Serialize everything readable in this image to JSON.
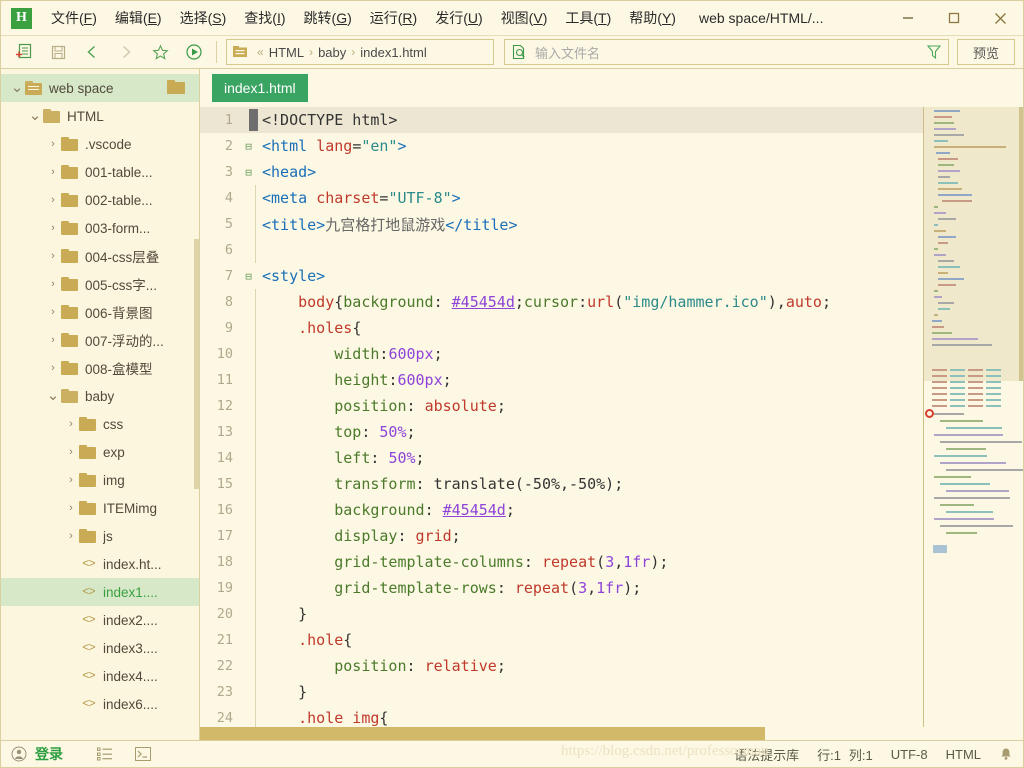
{
  "window": {
    "logo_text": "H",
    "title": "web space/HTML/...",
    "minimize": "—",
    "maximize": "□",
    "close": "✕"
  },
  "menu": [
    {
      "label": "文件",
      "accel": "F"
    },
    {
      "label": "编辑",
      "accel": "E"
    },
    {
      "label": "选择",
      "accel": "S"
    },
    {
      "label": "查找",
      "accel": "I"
    },
    {
      "label": "跳转",
      "accel": "G"
    },
    {
      "label": "运行",
      "accel": "R"
    },
    {
      "label": "发行",
      "accel": "U"
    },
    {
      "label": "视图",
      "accel": "V"
    },
    {
      "label": "工具",
      "accel": "T"
    },
    {
      "label": "帮助",
      "accel": "Y"
    }
  ],
  "toolbar": {
    "icons": [
      "new-file-icon",
      "save-icon",
      "back-icon",
      "forward-icon",
      "favorite-icon",
      "run-icon"
    ],
    "breadcrumb": {
      "prefix": "«",
      "segments": [
        "HTML",
        "baby",
        "index1.html"
      ],
      "separator": "›"
    },
    "search_placeholder": "输入文件名",
    "filter_icon": "filter-icon",
    "preview_label": "预览"
  },
  "sidebar": {
    "items": [
      {
        "label": "web space",
        "type": "folder-open",
        "depth": 0,
        "arrow": "v",
        "selected": true,
        "trailing_folder": true
      },
      {
        "label": "HTML",
        "type": "folder-open",
        "depth": 1,
        "arrow": "v",
        "selected": false
      },
      {
        "label": ".vscode",
        "type": "folder",
        "depth": 2,
        "arrow": ">",
        "selected": false
      },
      {
        "label": "001-table...",
        "type": "folder",
        "depth": 2,
        "arrow": ">",
        "selected": false
      },
      {
        "label": "002-table...",
        "type": "folder",
        "depth": 2,
        "arrow": ">",
        "selected": false
      },
      {
        "label": "003-form...",
        "type": "folder",
        "depth": 2,
        "arrow": ">",
        "selected": false
      },
      {
        "label": "004-css层叠",
        "type": "folder",
        "depth": 2,
        "arrow": ">",
        "selected": false
      },
      {
        "label": "005-css字...",
        "type": "folder",
        "depth": 2,
        "arrow": ">",
        "selected": false
      },
      {
        "label": "006-背景图",
        "type": "folder",
        "depth": 2,
        "arrow": ">",
        "selected": false
      },
      {
        "label": "007-浮动的...",
        "type": "folder",
        "depth": 2,
        "arrow": ">",
        "selected": false
      },
      {
        "label": "008-盒模型",
        "type": "folder",
        "depth": 2,
        "arrow": ">",
        "selected": false
      },
      {
        "label": "baby",
        "type": "folder-open",
        "depth": 2,
        "arrow": "v",
        "selected": false
      },
      {
        "label": "css",
        "type": "folder",
        "depth": 3,
        "arrow": ">",
        "selected": false
      },
      {
        "label": "exp",
        "type": "folder",
        "depth": 3,
        "arrow": ">",
        "selected": false
      },
      {
        "label": "img",
        "type": "folder",
        "depth": 3,
        "arrow": ">",
        "selected": false
      },
      {
        "label": "ITEMimg",
        "type": "folder",
        "depth": 3,
        "arrow": ">",
        "selected": false
      },
      {
        "label": "js",
        "type": "folder",
        "depth": 3,
        "arrow": ">",
        "selected": false
      },
      {
        "label": "index.ht...",
        "type": "file",
        "depth": 3,
        "arrow": "",
        "selected": false
      },
      {
        "label": "index1....",
        "type": "file",
        "depth": 3,
        "arrow": "",
        "selected": true
      },
      {
        "label": "index2....",
        "type": "file",
        "depth": 3,
        "arrow": "",
        "selected": false
      },
      {
        "label": "index3....",
        "type": "file",
        "depth": 3,
        "arrow": "",
        "selected": false
      },
      {
        "label": "index4....",
        "type": "file",
        "depth": 3,
        "arrow": "",
        "selected": false
      },
      {
        "label": "index6....",
        "type": "file",
        "depth": 3,
        "arrow": "",
        "selected": false
      }
    ]
  },
  "editor": {
    "tabs": [
      {
        "label": "index1.html",
        "active": true
      }
    ],
    "current_line": 1,
    "lines": [
      {
        "n": 1,
        "fold": "",
        "guide": 0,
        "current": true,
        "tokens": [
          {
            "t": "<!DOCTYPE html>",
            "c": "t-plain"
          }
        ]
      },
      {
        "n": 2,
        "fold": "⊟",
        "guide": 0,
        "tokens": [
          {
            "t": "<html ",
            "c": "t-tag"
          },
          {
            "t": "lang",
            "c": "t-attr"
          },
          {
            "t": "=",
            "c": "t-punct"
          },
          {
            "t": "\"en\"",
            "c": "t-str"
          },
          {
            "t": ">",
            "c": "t-tag"
          }
        ]
      },
      {
        "n": 3,
        "fold": "⊟",
        "guide": 0,
        "tokens": [
          {
            "t": "<head>",
            "c": "t-tag"
          }
        ]
      },
      {
        "n": 4,
        "fold": "",
        "guide": 1,
        "tokens": [
          {
            "t": "<meta ",
            "c": "t-tag"
          },
          {
            "t": "charset",
            "c": "t-attr"
          },
          {
            "t": "=",
            "c": "t-punct"
          },
          {
            "t": "\"UTF-8\"",
            "c": "t-str"
          },
          {
            "t": ">",
            "c": "t-tag"
          }
        ]
      },
      {
        "n": 5,
        "fold": "",
        "guide": 1,
        "tokens": [
          {
            "t": "<title>",
            "c": "t-tag"
          },
          {
            "t": "九宫格打地鼠游戏",
            "c": "t-text"
          },
          {
            "t": "</title>",
            "c": "t-tag"
          }
        ]
      },
      {
        "n": 6,
        "fold": "",
        "guide": 1,
        "tokens": [
          {
            "t": "",
            "c": "t-plain"
          }
        ]
      },
      {
        "n": 7,
        "fold": "⊟",
        "guide": 0,
        "tokens": [
          {
            "t": "<style>",
            "c": "t-tag"
          }
        ]
      },
      {
        "n": 8,
        "fold": "",
        "guide": 1,
        "tokens": [
          {
            "t": "    ",
            "c": "t-plain"
          },
          {
            "t": "body",
            "c": "t-sel"
          },
          {
            "t": "{",
            "c": "t-punct"
          },
          {
            "t": "background",
            "c": "t-prop"
          },
          {
            "t": ": ",
            "c": "t-punct"
          },
          {
            "t": "#45454d",
            "c": "t-hex"
          },
          {
            "t": ";",
            "c": "t-punct"
          },
          {
            "t": "cursor",
            "c": "t-prop"
          },
          {
            "t": ":",
            "c": "t-punct"
          },
          {
            "t": "url",
            "c": "t-val"
          },
          {
            "t": "(",
            "c": "t-punct"
          },
          {
            "t": "\"img/hammer.ico\"",
            "c": "t-str"
          },
          {
            "t": ")",
            "c": "t-punct"
          },
          {
            "t": ",",
            "c": "t-punct"
          },
          {
            "t": "auto",
            "c": "t-val"
          },
          {
            "t": ";",
            "c": "t-punct"
          }
        ]
      },
      {
        "n": 9,
        "fold": "",
        "guide": 1,
        "tokens": [
          {
            "t": "    ",
            "c": "t-plain"
          },
          {
            "t": ".holes",
            "c": "t-sel"
          },
          {
            "t": "{",
            "c": "t-punct"
          }
        ]
      },
      {
        "n": 10,
        "fold": "",
        "guide": 1,
        "tokens": [
          {
            "t": "        ",
            "c": "t-plain"
          },
          {
            "t": "width",
            "c": "t-prop"
          },
          {
            "t": ":",
            "c": "t-punct"
          },
          {
            "t": "600px",
            "c": "t-num"
          },
          {
            "t": ";",
            "c": "t-punct"
          }
        ]
      },
      {
        "n": 11,
        "fold": "",
        "guide": 1,
        "tokens": [
          {
            "t": "        ",
            "c": "t-plain"
          },
          {
            "t": "height",
            "c": "t-prop"
          },
          {
            "t": ":",
            "c": "t-punct"
          },
          {
            "t": "600px",
            "c": "t-num"
          },
          {
            "t": ";",
            "c": "t-punct"
          }
        ]
      },
      {
        "n": 12,
        "fold": "",
        "guide": 1,
        "tokens": [
          {
            "t": "        ",
            "c": "t-plain"
          },
          {
            "t": "position",
            "c": "t-prop"
          },
          {
            "t": ": ",
            "c": "t-punct"
          },
          {
            "t": "absolute",
            "c": "t-val"
          },
          {
            "t": ";",
            "c": "t-punct"
          }
        ]
      },
      {
        "n": 13,
        "fold": "",
        "guide": 1,
        "tokens": [
          {
            "t": "        ",
            "c": "t-plain"
          },
          {
            "t": "top",
            "c": "t-prop"
          },
          {
            "t": ": ",
            "c": "t-punct"
          },
          {
            "t": "50%",
            "c": "t-num"
          },
          {
            "t": ";",
            "c": "t-punct"
          }
        ]
      },
      {
        "n": 14,
        "fold": "",
        "guide": 1,
        "tokens": [
          {
            "t": "        ",
            "c": "t-plain"
          },
          {
            "t": "left",
            "c": "t-prop"
          },
          {
            "t": ": ",
            "c": "t-punct"
          },
          {
            "t": "50%",
            "c": "t-num"
          },
          {
            "t": ";",
            "c": "t-punct"
          }
        ]
      },
      {
        "n": 15,
        "fold": "",
        "guide": 1,
        "tokens": [
          {
            "t": "        ",
            "c": "t-plain"
          },
          {
            "t": "transform",
            "c": "t-prop"
          },
          {
            "t": ": ",
            "c": "t-punct"
          },
          {
            "t": "translate",
            "c": "t-plain"
          },
          {
            "t": "(-50%,-50%);",
            "c": "t-plain"
          }
        ]
      },
      {
        "n": 16,
        "fold": "",
        "guide": 1,
        "tokens": [
          {
            "t": "        ",
            "c": "t-plain"
          },
          {
            "t": "background",
            "c": "t-prop"
          },
          {
            "t": ": ",
            "c": "t-punct"
          },
          {
            "t": "#45454d",
            "c": "t-hex"
          },
          {
            "t": ";",
            "c": "t-punct"
          }
        ]
      },
      {
        "n": 17,
        "fold": "",
        "guide": 1,
        "tokens": [
          {
            "t": "        ",
            "c": "t-plain"
          },
          {
            "t": "display",
            "c": "t-prop"
          },
          {
            "t": ": ",
            "c": "t-punct"
          },
          {
            "t": "grid",
            "c": "t-val"
          },
          {
            "t": ";",
            "c": "t-punct"
          }
        ]
      },
      {
        "n": 18,
        "fold": "",
        "guide": 1,
        "tokens": [
          {
            "t": "        ",
            "c": "t-plain"
          },
          {
            "t": "grid-template-columns",
            "c": "t-prop"
          },
          {
            "t": ": ",
            "c": "t-punct"
          },
          {
            "t": "repeat",
            "c": "t-val"
          },
          {
            "t": "(",
            "c": "t-punct"
          },
          {
            "t": "3",
            "c": "t-num"
          },
          {
            "t": ",",
            "c": "t-punct"
          },
          {
            "t": "1fr",
            "c": "t-num"
          },
          {
            "t": ");",
            "c": "t-punct"
          }
        ]
      },
      {
        "n": 19,
        "fold": "",
        "guide": 1,
        "tokens": [
          {
            "t": "        ",
            "c": "t-plain"
          },
          {
            "t": "grid-template-rows",
            "c": "t-prop"
          },
          {
            "t": ": ",
            "c": "t-punct"
          },
          {
            "t": "repeat",
            "c": "t-val"
          },
          {
            "t": "(",
            "c": "t-punct"
          },
          {
            "t": "3",
            "c": "t-num"
          },
          {
            "t": ",",
            "c": "t-punct"
          },
          {
            "t": "1fr",
            "c": "t-num"
          },
          {
            "t": ");",
            "c": "t-punct"
          }
        ]
      },
      {
        "n": 20,
        "fold": "",
        "guide": 1,
        "tokens": [
          {
            "t": "    ",
            "c": "t-plain"
          },
          {
            "t": "}",
            "c": "t-punct"
          }
        ]
      },
      {
        "n": 21,
        "fold": "",
        "guide": 1,
        "tokens": [
          {
            "t": "    ",
            "c": "t-plain"
          },
          {
            "t": ".hole",
            "c": "t-sel"
          },
          {
            "t": "{",
            "c": "t-punct"
          }
        ]
      },
      {
        "n": 22,
        "fold": "",
        "guide": 1,
        "tokens": [
          {
            "t": "        ",
            "c": "t-plain"
          },
          {
            "t": "position",
            "c": "t-prop"
          },
          {
            "t": ": ",
            "c": "t-punct"
          },
          {
            "t": "relative",
            "c": "t-val"
          },
          {
            "t": ";",
            "c": "t-punct"
          }
        ]
      },
      {
        "n": 23,
        "fold": "",
        "guide": 1,
        "tokens": [
          {
            "t": "    ",
            "c": "t-plain"
          },
          {
            "t": "}",
            "c": "t-punct"
          }
        ]
      },
      {
        "n": 24,
        "fold": "",
        "guide": 1,
        "tokens": [
          {
            "t": "    ",
            "c": "t-plain"
          },
          {
            "t": ".hole img",
            "c": "t-sel"
          },
          {
            "t": "{",
            "c": "t-punct"
          }
        ]
      }
    ]
  },
  "statusbar": {
    "login_label": "登录",
    "account_icon": "account-icon",
    "list_icon": "list-icon",
    "terminal_icon": "terminal-icon",
    "syntax_label": "语法提示库",
    "row_label": "行:1",
    "col_label": "列:1",
    "encoding": "UTF-8",
    "language": "HTML",
    "bell_icon": "bell-icon",
    "watermark": "https://blog.csdn.net/professorman"
  },
  "colors": {
    "accent_green": "#3aa463",
    "panel_bg": "#fdf8e4",
    "sidebar_bg": "#fdf6df",
    "selection_green": "#d6e8c8",
    "border": "#d9cfa0",
    "folder_gold": "#c8ab54",
    "scrollbar_gold": "#d2b96a"
  }
}
